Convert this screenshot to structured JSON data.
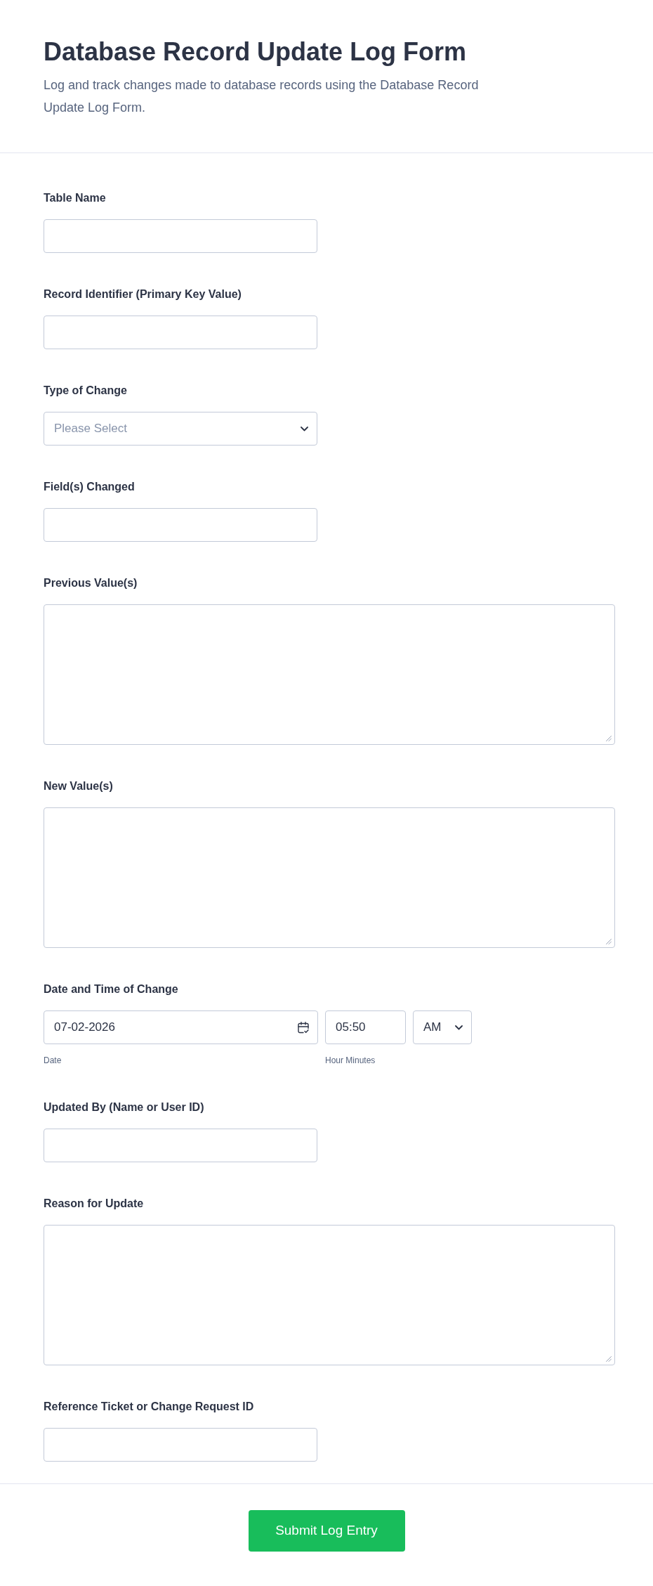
{
  "header": {
    "title": "Database Record Update Log Form",
    "description": "Log and track changes made to database records using the Database Record Update Log Form."
  },
  "fields": [
    {
      "kind": "text",
      "label": "Table Name"
    },
    {
      "kind": "text",
      "label": "Record Identifier (Primary Key Value)"
    },
    {
      "kind": "select",
      "label": "Type of Change",
      "placeholder": "Please Select"
    },
    {
      "kind": "text",
      "label": "Field(s) Changed"
    },
    {
      "kind": "textarea",
      "label": "Previous Value(s)"
    },
    {
      "kind": "textarea",
      "label": "New Value(s)"
    },
    {
      "kind": "datetime",
      "label": "Date and Time of Change",
      "date": {
        "value": "07-02-2026",
        "sublabel": "Date"
      },
      "time": {
        "value": "05:50",
        "sublabel": "Hour Minutes"
      },
      "period": {
        "value": "AM"
      }
    },
    {
      "kind": "text",
      "label": "Updated By (Name or User ID)"
    },
    {
      "kind": "textarea",
      "label": "Reason for Update"
    },
    {
      "kind": "text",
      "label": "Reference Ticket or Change Request ID"
    }
  ],
  "submit_button": {
    "label": "Submit Log Entry"
  }
}
